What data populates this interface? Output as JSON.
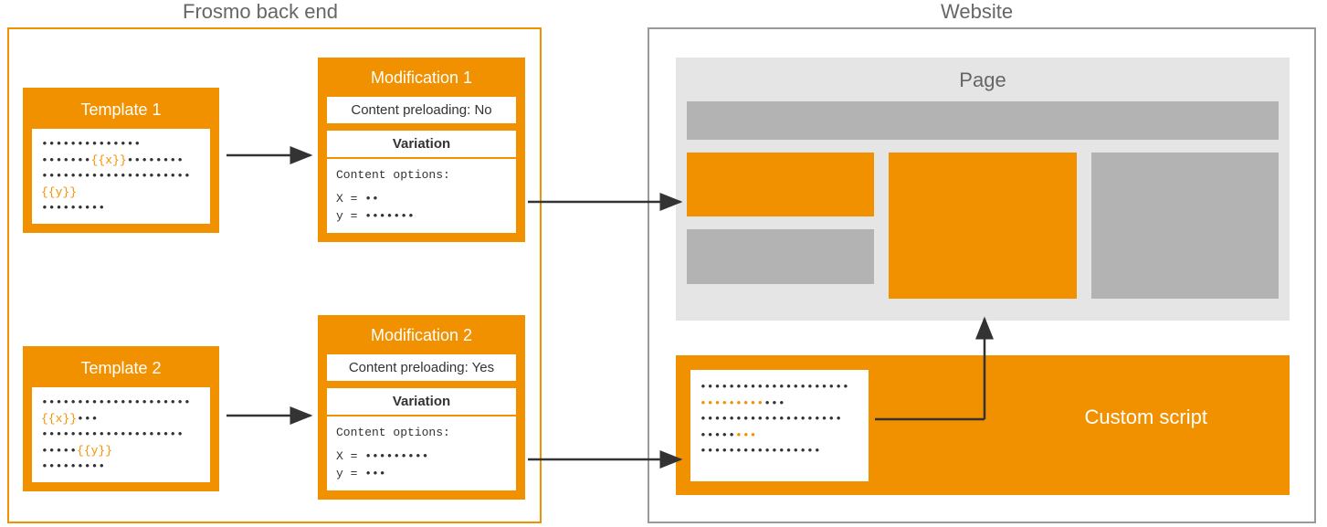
{
  "titles": {
    "backend": "Frosmo back end",
    "website": "Website",
    "page": "Page",
    "custom_script": "Custom script"
  },
  "templates": [
    {
      "title": "Template 1",
      "lines": [
        {
          "pre": "••••••••••••••",
          "var": "",
          "post": ""
        },
        {
          "pre": "•••••••",
          "var": "{{x}}",
          "post": "••••••••"
        },
        {
          "pre": "•••••••••••••••••••••",
          "var": "",
          "post": ""
        },
        {
          "pre": "",
          "var": "{{y}}",
          "post": ""
        },
        {
          "pre": "•••••••••",
          "var": "",
          "post": ""
        }
      ]
    },
    {
      "title": "Template 2",
      "lines": [
        {
          "pre": "•••••••••••••••••••••",
          "var": "",
          "post": ""
        },
        {
          "pre": "",
          "var": "{{x}}",
          "post": "•••"
        },
        {
          "pre": "••••••••••••••••••••",
          "var": "",
          "post": ""
        },
        {
          "pre": "•••••",
          "var": "{{y}}",
          "post": ""
        },
        {
          "pre": "•••••••••",
          "var": "",
          "post": ""
        }
      ]
    }
  ],
  "modifications": [
    {
      "title": "Modification 1",
      "preloading": "Content preloading: No",
      "variation": "Variation",
      "opts_label": "Content options:",
      "x": "X = ••",
      "y": "y = •••••••"
    },
    {
      "title": "Modification 2",
      "preloading": "Content preloading: Yes",
      "variation": "Variation",
      "opts_label": "Content options:",
      "x": "X = •••••••••",
      "y": "y = •••"
    }
  ],
  "script_output": {
    "lines": [
      {
        "black": "•••••••••••••••••••••"
      },
      {
        "orange": "•••••••••",
        "black": "•••"
      },
      {
        "black": "••••••••••••••••••••"
      },
      {
        "black_pre": "•••••",
        "orange": "•••",
        "black": ""
      },
      {
        "black": "•••••••••••••••••"
      }
    ]
  }
}
